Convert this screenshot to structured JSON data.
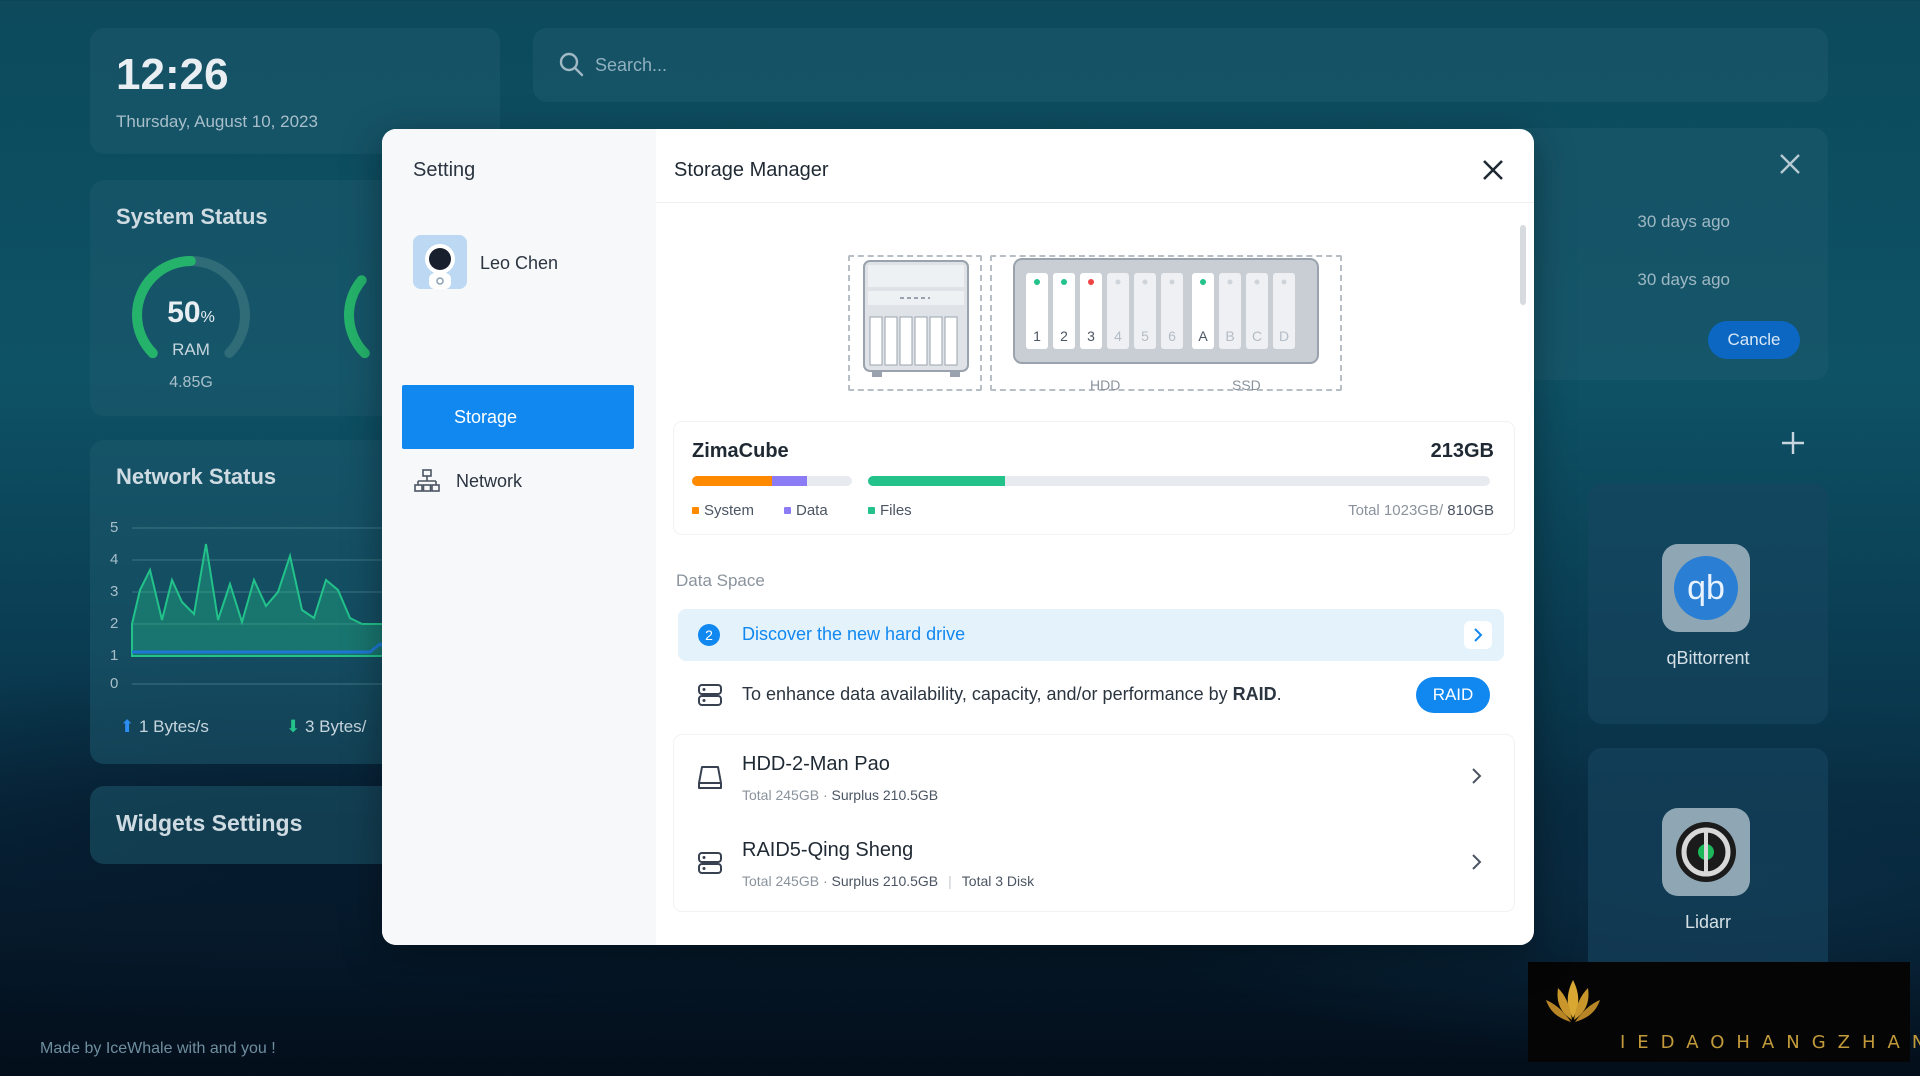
{
  "clock": {
    "time": "12:26",
    "date": "Thursday, August 10, 2023"
  },
  "search": {
    "placeholder": "Search..."
  },
  "system_status": {
    "title": "System Status",
    "ram": {
      "percent": "50",
      "unit": "%",
      "label": "RAM",
      "value": "4.85G"
    }
  },
  "network_status": {
    "title": "Network Status",
    "y_ticks": [
      "5",
      "4",
      "3",
      "2",
      "1",
      "0"
    ],
    "upload": "1 Bytes/s",
    "download": "3 Bytes/"
  },
  "widgets_settings": {
    "title": "Widgets Settings"
  },
  "notifications": {
    "items": [
      {
        "time": "30 days ago"
      },
      {
        "time": "30 days ago"
      }
    ],
    "cancel_label": "Cancle"
  },
  "apps": [
    {
      "name": "qBittorrent",
      "icon": "qb"
    },
    {
      "name": "Lidarr",
      "icon": ""
    }
  ],
  "footer": {
    "made_by": "Made by IceWhale with and you !"
  },
  "watermark": {
    "text": "IEDAOHANGZHAN"
  },
  "setting": {
    "title": "Setting",
    "user": "Leo Chen",
    "nav": [
      {
        "label": "Network",
        "icon": "network-icon"
      },
      {
        "label": "Storage",
        "icon": "storage",
        "active": true
      }
    ]
  },
  "storage_manager": {
    "title": "Storage Manager",
    "diagram": {
      "hdd_slots": [
        "1",
        "2",
        "3",
        "4",
        "5",
        "6"
      ],
      "ssd_slots": [
        "A",
        "B",
        "C",
        "D"
      ],
      "hdd_label": "HDD",
      "ssd_label": "SSD"
    },
    "device": {
      "name": "ZimaCube",
      "size": "213GB",
      "legend": {
        "system": "System",
        "data": "Data",
        "files": "Files"
      },
      "total_prefix": "Total 1023GB/",
      "total_used": "810GB",
      "usage": {
        "system_fraction": 0.5,
        "data_fraction": 0.22,
        "files_fraction": 0.22
      }
    },
    "data_space_label": "Data Space",
    "discover": {
      "icon_text": "2",
      "text": "Discover the new hard drive"
    },
    "raid": {
      "text_prefix": "To enhance data availability, capacity, and/or performance by ",
      "text_strong": "RAID",
      "text_suffix": ".",
      "button": "RAID"
    },
    "disks": [
      {
        "name": "HDD-2-Man Pao",
        "total": "Total 245GB",
        "dot": "·",
        "surplus": "Surplus 210.5GB",
        "extra": ""
      },
      {
        "name": "RAID5-Qing Sheng",
        "total": "Total 245GB",
        "dot": "·",
        "surplus": "Surplus 210.5GB",
        "extra": "Total 3 Disk"
      }
    ]
  },
  "colors": {
    "accent": "#1188f0",
    "system": "#ff8a00",
    "data": "#8b7cf6",
    "files": "#22c28a"
  }
}
